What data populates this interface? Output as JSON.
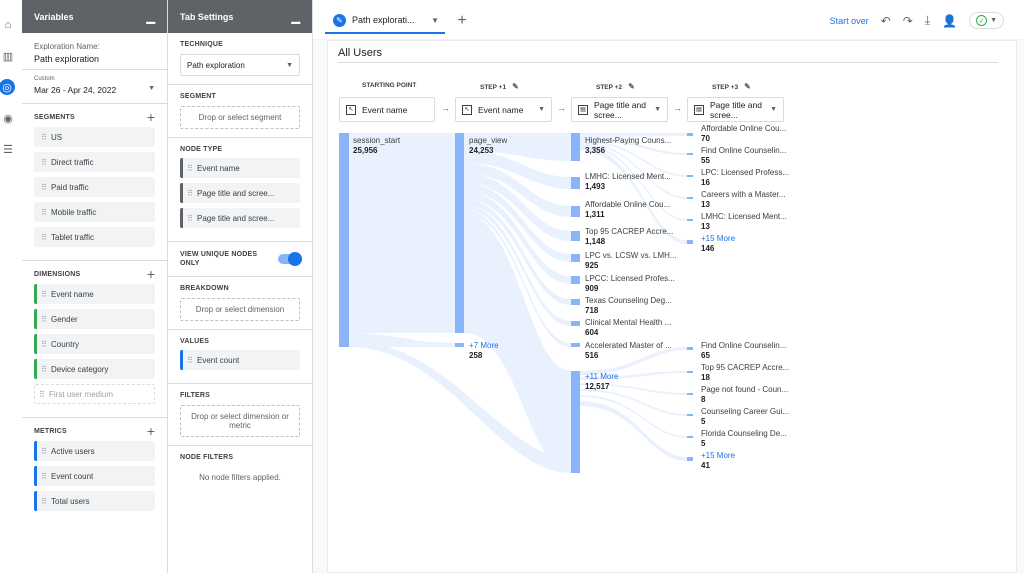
{
  "nav": {
    "items": [
      "home-icon",
      "reports-icon",
      "explore-icon",
      "advertising-icon",
      "configure-icon"
    ]
  },
  "variables": {
    "header": "Variables",
    "exploration_label": "Exploration Name:",
    "exploration_name": "Path exploration",
    "date_badge": "Custom",
    "date_range": "Mar 26 - Apr 24, 2022",
    "segments_label": "SEGMENTS",
    "segments": [
      "US",
      "Direct traffic",
      "Paid traffic",
      "Mobile traffic",
      "Tablet traffic"
    ],
    "dimensions_label": "DIMENSIONS",
    "dimensions": [
      "Event name",
      "Gender",
      "Country",
      "Device category"
    ],
    "dimension_disabled": "First user medium",
    "metrics_label": "METRICS",
    "metrics": [
      "Active users",
      "Event count",
      "Total users"
    ]
  },
  "tab_settings": {
    "header": "Tab Settings",
    "technique_label": "TECHNIQUE",
    "technique_value": "Path exploration",
    "segment_label": "SEGMENT",
    "segment_drop": "Drop or select segment",
    "node_type_label": "NODE TYPE",
    "node_types": [
      "Event name",
      "Page title and scree...",
      "Page title and scree..."
    ],
    "unique_nodes_label": "VIEW UNIQUE NODES ONLY",
    "breakdown_label": "BREAKDOWN",
    "breakdown_drop": "Drop or select dimension",
    "values_label": "VALUES",
    "values_chip": "Event count",
    "filters_label": "FILTERS",
    "filters_drop": "Drop or select dimension or metric",
    "node_filters_label": "NODE FILTERS",
    "node_filters_text": "No node filters applied."
  },
  "toolbar": {
    "tab_label": "Path explorati...",
    "start_over": "Start over"
  },
  "canvas": {
    "title": "All Users",
    "steps": [
      {
        "label": "STARTING POINT",
        "dropdown": "Event name"
      },
      {
        "label": "STEP +1",
        "dropdown": "Event name"
      },
      {
        "label": "STEP +2",
        "dropdown": "Page title and scree..."
      },
      {
        "label": "STEP +3",
        "dropdown": "Page title and scree..."
      }
    ],
    "col0": [
      {
        "label": "session_start",
        "value": "25,956"
      }
    ],
    "col1": [
      {
        "label": "page_view",
        "value": "24,253"
      }
    ],
    "col1_more": {
      "label": "+7 More",
      "value": "258"
    },
    "col2": [
      {
        "label": "Highest-Paying Couns...",
        "value": "3,356"
      },
      {
        "label": "LMHC: Licensed Ment...",
        "value": "1,493"
      },
      {
        "label": "Affordable Online Cou...",
        "value": "1,311"
      },
      {
        "label": "Top 95 CACREP Accre...",
        "value": "1,148"
      },
      {
        "label": "LPC vs. LCSW vs. LMH...",
        "value": "925"
      },
      {
        "label": "LPCC: Licensed Profes...",
        "value": "909"
      },
      {
        "label": "Texas Counseling Deg...",
        "value": "718"
      },
      {
        "label": "Clinical Mental Health ...",
        "value": "604"
      },
      {
        "label": "Accelerated Master of ...",
        "value": "516"
      }
    ],
    "col2_more": {
      "label": "+11 More",
      "value": "12,517"
    },
    "col3a": [
      {
        "label": "Affordable Online Cou...",
        "value": "70"
      },
      {
        "label": "Find Online Counselin...",
        "value": "55"
      },
      {
        "label": "LPC: Licensed Profess...",
        "value": "16"
      },
      {
        "label": "Careers with a Master...",
        "value": "13"
      },
      {
        "label": "LMHC: Licensed Ment...",
        "value": "13"
      }
    ],
    "col3a_more": {
      "label": "+15 More",
      "value": "146"
    },
    "col3b": [
      {
        "label": "Find Online Counselin...",
        "value": "65"
      },
      {
        "label": "Top 95 CACREP Accre...",
        "value": "18"
      },
      {
        "label": "Page not found - Coun...",
        "value": "8"
      },
      {
        "label": "Counseling Career Gui...",
        "value": "5"
      },
      {
        "label": "Florida Counseling De...",
        "value": "5"
      }
    ],
    "col3b_more": {
      "label": "+15 More",
      "value": "41"
    }
  },
  "colors": {
    "accent": "#1a73e8",
    "node": "#8ab4f8",
    "flow": "#e8f0fe",
    "dimension": "#34a853"
  }
}
